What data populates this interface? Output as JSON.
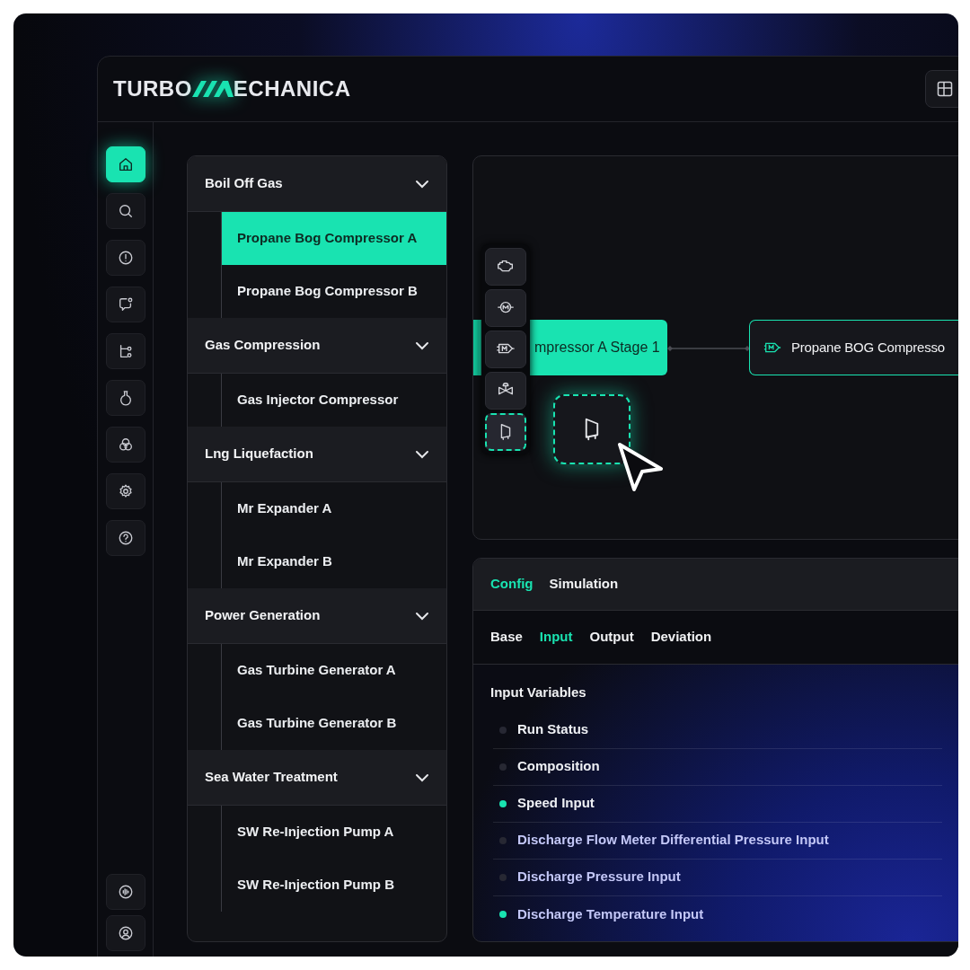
{
  "logo": {
    "left": "TURBO",
    "right": "ECHANICA"
  },
  "sidebar": {
    "items": [
      {
        "kind": "home",
        "selected": true
      },
      {
        "kind": "search",
        "selected": false
      },
      {
        "kind": "alert",
        "selected": false
      },
      {
        "kind": "chat",
        "selected": false
      },
      {
        "kind": "flow",
        "selected": false
      },
      {
        "kind": "flask",
        "selected": false
      },
      {
        "kind": "circles",
        "selected": false
      },
      {
        "kind": "settings",
        "selected": false
      },
      {
        "kind": "help",
        "selected": false
      }
    ],
    "bottom_items": [
      {
        "kind": "audio",
        "selected": false
      },
      {
        "kind": "user",
        "selected": false
      }
    ]
  },
  "tree": [
    {
      "title": "Boil Off Gas",
      "expanded": true,
      "children": [
        {
          "label": "Propane Bog Compressor A",
          "selected": true
        },
        {
          "label": "Propane Bog Compressor B",
          "selected": false
        }
      ]
    },
    {
      "title": "Gas Compression",
      "expanded": true,
      "children": [
        {
          "label": "Gas Injector Compressor",
          "selected": false
        }
      ]
    },
    {
      "title": "Lng Liquefaction",
      "expanded": true,
      "children": [
        {
          "label": "Mr Expander A",
          "selected": false
        },
        {
          "label": "Mr Expander B",
          "selected": false
        }
      ]
    },
    {
      "title": "Power Generation",
      "expanded": true,
      "children": [
        {
          "label": "Gas Turbine Generator A",
          "selected": false
        },
        {
          "label": "Gas Turbine Generator B",
          "selected": false
        }
      ]
    },
    {
      "title": "Sea Water Treatment",
      "expanded": true,
      "children": [
        {
          "label": "SW Re-Injection Pump A",
          "selected": false
        },
        {
          "label": "SW Re-Injection Pump B",
          "selected": false
        }
      ]
    }
  ],
  "canvas": {
    "palette": [
      {
        "kind": "engine",
        "selected": false
      },
      {
        "kind": "motor",
        "selected": false
      },
      {
        "kind": "compressor",
        "selected": false
      },
      {
        "kind": "valve",
        "selected": false
      },
      {
        "kind": "tank",
        "selected": true
      }
    ],
    "nodes": [
      {
        "label": "mpressor A Stage 1",
        "selected": true
      },
      {
        "label": "Propane BOG Compresso",
        "selected": false
      }
    ]
  },
  "panel": {
    "tabs": [
      {
        "label": "Config",
        "selected": true
      },
      {
        "label": "Simulation",
        "selected": false
      }
    ],
    "subtabs": [
      {
        "label": "Base",
        "selected": false
      },
      {
        "label": "Input",
        "selected": true
      },
      {
        "label": "Output",
        "selected": false
      },
      {
        "label": "Deviation",
        "selected": false
      }
    ],
    "section_title": "Input Variables",
    "variables": [
      {
        "label": "Run Status",
        "active": false
      },
      {
        "label": "Composition",
        "active": false
      },
      {
        "label": "Speed Input",
        "active": true
      },
      {
        "label": "Discharge Flow Meter Differential Pressure Input",
        "active": false
      },
      {
        "label": "Discharge Pressure Input",
        "active": false
      },
      {
        "label": "Discharge Temperature Input",
        "active": true
      }
    ]
  }
}
